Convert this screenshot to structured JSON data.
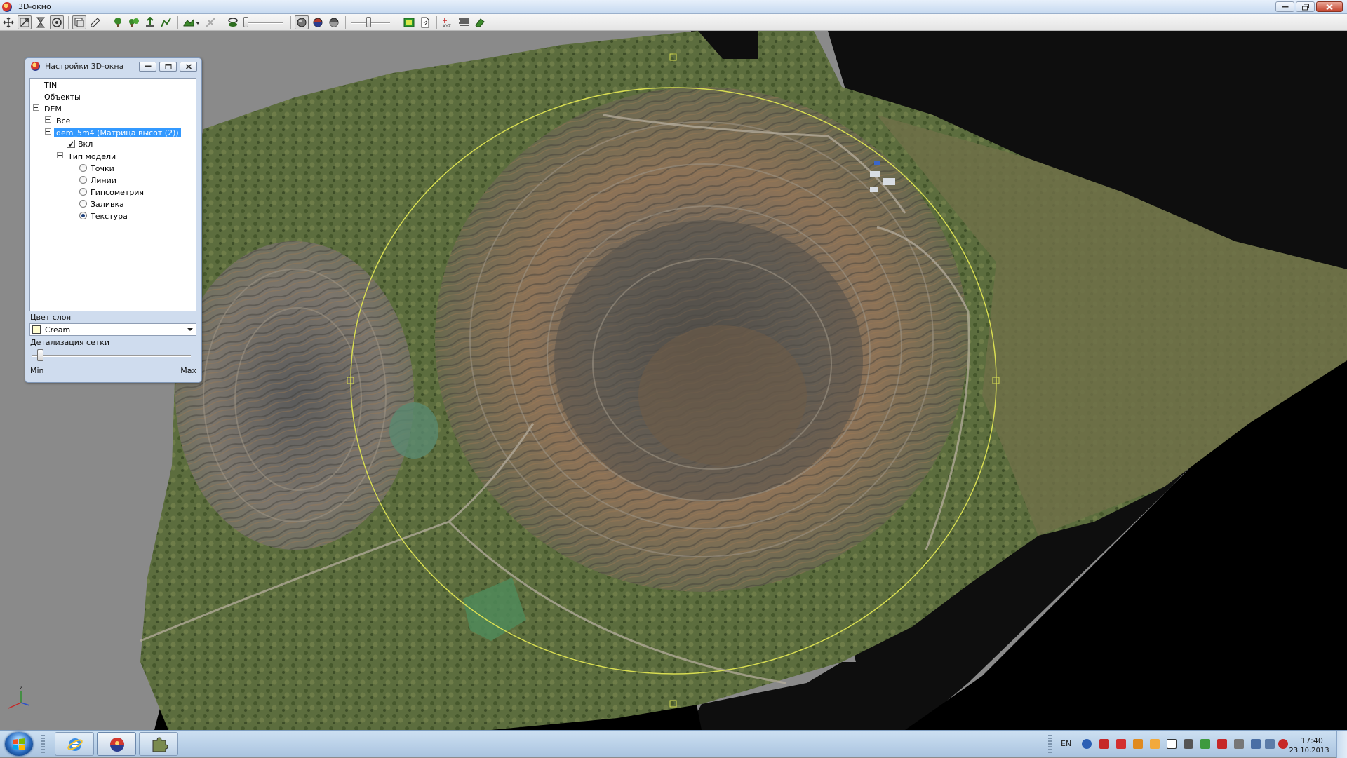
{
  "window": {
    "title": "3D-окно",
    "controls": [
      "minimize",
      "restore",
      "close"
    ]
  },
  "toolbar": {
    "buttons": [
      {
        "icon": "pan-icon"
      },
      {
        "icon": "select-icon",
        "pressed": true
      },
      {
        "icon": "hourglass-icon"
      },
      {
        "icon": "rotate-icon",
        "pressed": true
      },
      {
        "icon": "layers-icon",
        "pressed": true
      },
      {
        "icon": "edit-icon"
      },
      {
        "icon": "tree-add-icon"
      },
      {
        "icon": "tree-group-icon"
      },
      {
        "icon": "elevation-icon"
      },
      {
        "icon": "profile-icon"
      },
      {
        "icon": "terrain-dropdown-icon"
      },
      {
        "icon": "disabled-tool-icon"
      },
      {
        "icon": "camera-path-icon"
      },
      {
        "icon": "slider-icon"
      },
      {
        "icon": "sphere-gray-icon",
        "pressed": true
      },
      {
        "icon": "sphere-color-icon"
      },
      {
        "icon": "sphere-shaded-icon"
      },
      {
        "icon": "slider-icon"
      },
      {
        "icon": "map-green-icon"
      },
      {
        "icon": "document-icon"
      },
      {
        "icon": "xyz-axis-icon"
      },
      {
        "icon": "list-icon"
      },
      {
        "icon": "eraser-icon"
      }
    ]
  },
  "settings_panel": {
    "title": "Настройки 3D-окна",
    "tree": {
      "tin": "TIN",
      "objects": "Объекты",
      "dem": "DEM",
      "all": "Все",
      "layer": "dem_5m4 (Матрица высот (2))",
      "on_label": "Вкл",
      "on_checked": true,
      "model_type": "Тип модели",
      "options": [
        {
          "label": "Точки",
          "selected": false
        },
        {
          "label": "Линии",
          "selected": false
        },
        {
          "label": "Гипсометрия",
          "selected": false
        },
        {
          "label": "Заливка",
          "selected": false
        },
        {
          "label": "Текстура",
          "selected": true
        }
      ]
    },
    "layer_color": {
      "label": "Цвет слоя",
      "value": "Cream",
      "swatch": "#fffdd0"
    },
    "mesh_detail": {
      "label": "Детализация сетки",
      "min": "Min",
      "max": "Max",
      "level": 0.03
    }
  },
  "viewport": {
    "background": "#8a8a8a",
    "terrain": "textured 3D DEM of an open-pit mine",
    "navigation_circle_color": "#d8dd52"
  },
  "taskbar": {
    "apps": [
      {
        "name": "internet-explorer-icon",
        "active": false
      },
      {
        "name": "3d-app-icon",
        "active": true
      },
      {
        "name": "puzzle-app-icon",
        "active": false
      }
    ],
    "language": "EN",
    "tray_icons": [
      "network-icon",
      "acrobat-icon",
      "pdf-icon",
      "tool-icon",
      "app-orange-icon",
      "document-x-icon",
      "volume-icon",
      "battery-icon",
      "flag-icon",
      "usb-icon",
      "monitor-icon",
      "display-icon",
      "antivirus-icon"
    ],
    "time": "17:40",
    "date": "23.10.2013"
  }
}
